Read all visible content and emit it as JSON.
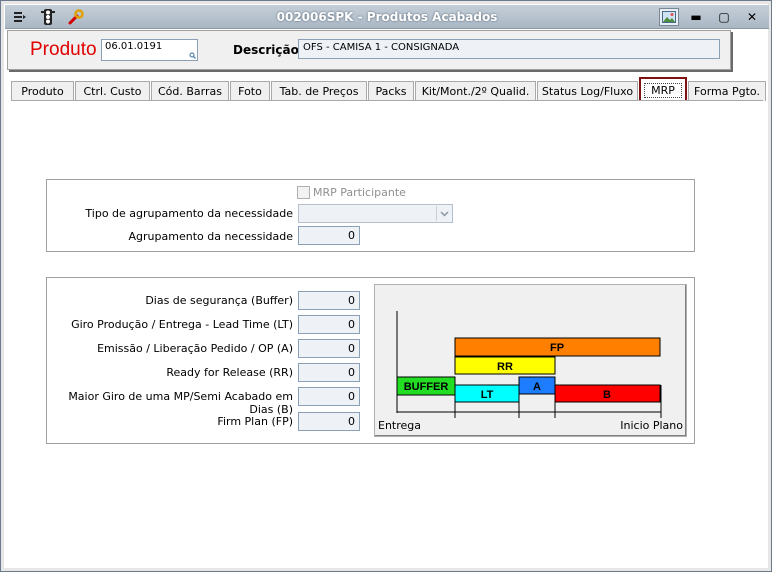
{
  "window": {
    "title": "002006SPK - Produtos Acabados",
    "icons": [
      "menu-icon",
      "traffic-light-icon",
      "wrench-icon",
      "image-icon"
    ],
    "controls": {
      "minimize": "▬",
      "maximize": "▢",
      "close": "✕"
    }
  },
  "header": {
    "produto_label": "Produto",
    "produto_value": "06.01.0191",
    "descricao_label": "Descrição",
    "descricao_value": "OFS - CAMISA 1 - CONSIGNADA",
    "accent_color": "#e00000"
  },
  "tabs": [
    {
      "label": "Produto"
    },
    {
      "label": "Ctrl. Custo"
    },
    {
      "label": "Cód. Barras"
    },
    {
      "label": "Foto"
    },
    {
      "label": "Tab. de Preços"
    },
    {
      "label": "Packs"
    },
    {
      "label": "Kit/Mont./2º Qualid."
    },
    {
      "label": "Status Log/Fluxo"
    },
    {
      "label": "MRP",
      "active": true
    },
    {
      "label": "Forma Pgto."
    }
  ],
  "group1": {
    "mrp_participante_label": "MRP Participante",
    "mrp_participante_checked": false,
    "tipo_agrupamento_label": "Tipo de agrupamento da necessidade",
    "tipo_agrupamento_value": "",
    "agrupamento_label": "Agrupamento da necessidade",
    "agrupamento_value": "0"
  },
  "group2": {
    "fields": [
      {
        "label": "Dias de segurança (Buffer)",
        "value": "0"
      },
      {
        "label": "Giro Produção / Entrega - Lead Time (LT)",
        "value": "0"
      },
      {
        "label": "Emissão / Liberação Pedido / OP (A)",
        "value": "0"
      },
      {
        "label": "Ready for Release (RR)",
        "value": "0"
      },
      {
        "label": "Maior Giro de uma MP/Semi Acabado em Dias (B)",
        "value": "0"
      },
      {
        "label": "Firm Plan (FP)",
        "value": "0"
      }
    ]
  },
  "diagram": {
    "left_label": "Entrega",
    "right_label": "Inicio Plano",
    "blocks": [
      {
        "label": "FP",
        "color": "#ff8000"
      },
      {
        "label": "RR",
        "color": "#ffff00"
      },
      {
        "label": "BUFFER",
        "color": "#22dd22"
      },
      {
        "label": "LT",
        "color": "#00ffff"
      },
      {
        "label": "A",
        "color": "#1e7cff"
      },
      {
        "label": "B",
        "color": "#ff0000"
      }
    ]
  }
}
